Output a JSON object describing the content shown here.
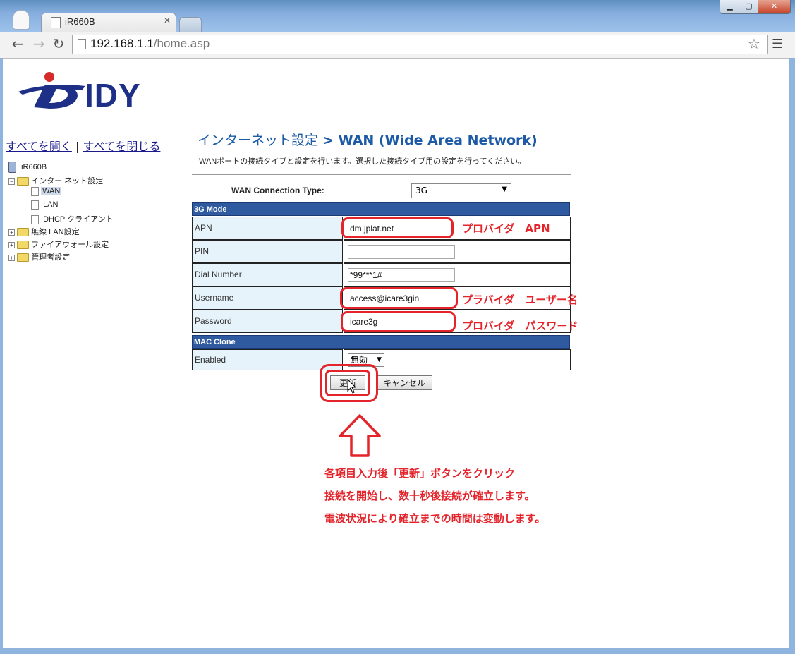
{
  "browser": {
    "tab_title": "iR660B",
    "url_host": "192.168.1.1",
    "url_path": "/home.asp"
  },
  "logo": {
    "text": "IDY"
  },
  "sidebar": {
    "expand_all": "すべてを開く",
    "separator": "|",
    "collapse_all": "すべてを閉じる",
    "tree": {
      "root": "iR660B",
      "internet": "インター ネット設定",
      "wan": "WAN",
      "lan": "LAN",
      "dhcp": "DHCP クライアント",
      "wireless": "無線 LAN設定",
      "firewall": "ファイアウォール設定",
      "admin": "管理者設定"
    }
  },
  "main": {
    "title_prefix": "インターネット設定",
    "title_main": "> WAN (Wide Area Network)",
    "description": "WANポートの接続タイプと設定を行います。選択した接続タイプ用の設定を行ってください。",
    "connection_type_label": "WAN Connection Type:",
    "connection_type_value": "3G",
    "section_3g": "3G Mode",
    "fields": {
      "apn_label": "APN",
      "apn_value": "dm.jplat.net",
      "pin_label": "PIN",
      "pin_value": "",
      "dial_label": "Dial Number",
      "dial_value": "*99***1#",
      "username_label": "Username",
      "username_value": "access@icare3gin",
      "password_label": "Password",
      "password_value": "icare3g"
    },
    "section_mac": "MAC Clone",
    "enabled_label": "Enabled",
    "enabled_value": "無効",
    "update_button": "更新",
    "cancel_button": "キャンセル"
  },
  "annotations": {
    "apn": "プロバイダ　APN",
    "username": "プラバイダ　ユーザー名",
    "password": "プロバイダ　パスワード",
    "line1": "各項目入力後「更新」ボタンをクリック",
    "line2": "接続を開始し、数十秒後接続が確立します。",
    "line3": "電波状況により確立までの時間は変動します。"
  },
  "colors": {
    "accent": "#1c5aa6",
    "annotation": "#e4242b",
    "section": "#2f5aa0"
  }
}
